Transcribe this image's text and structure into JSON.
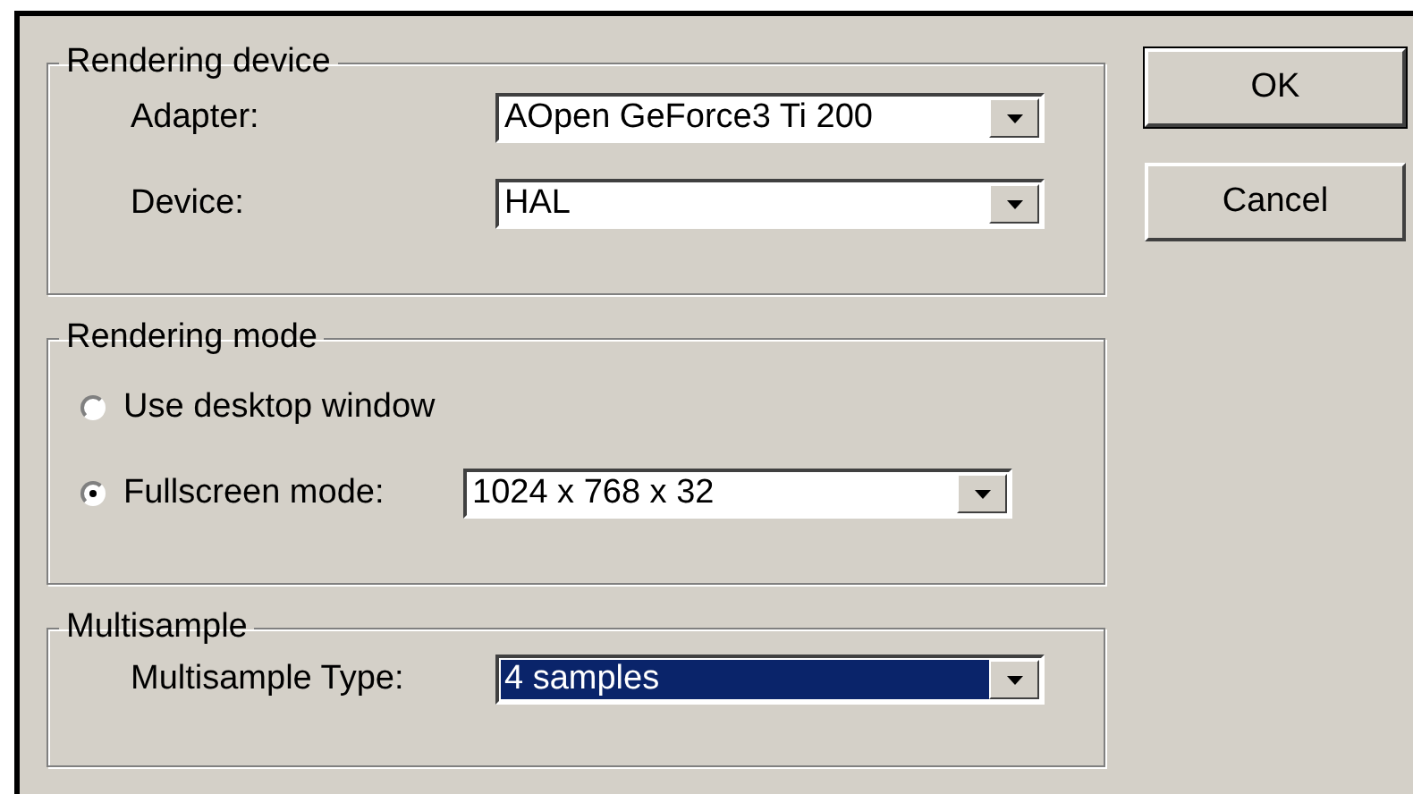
{
  "groups": [
    {
      "title": "Rendering device",
      "rows": [
        {
          "kind": "combo",
          "label": "Adapter:",
          "value": "AOpen GeForce3 Ti 200",
          "highlighted": false
        },
        {
          "kind": "combo",
          "label": "Device:",
          "value": "HAL",
          "highlighted": false
        }
      ]
    },
    {
      "title": "Rendering mode",
      "rows": [
        {
          "kind": "radio",
          "label": "Use desktop window",
          "selected": false
        },
        {
          "kind": "radio-combo",
          "label": "Fullscreen mode:",
          "selected": true,
          "value": "1024 x 768 x 32",
          "highlighted": false
        }
      ]
    },
    {
      "title": "Multisample",
      "rows": [
        {
          "kind": "combo",
          "label": "Multisample Type:",
          "value": "4 samples",
          "highlighted": true
        }
      ]
    }
  ],
  "buttons": [
    {
      "label": "OK",
      "default": true
    },
    {
      "label": "Cancel",
      "default": false
    }
  ]
}
